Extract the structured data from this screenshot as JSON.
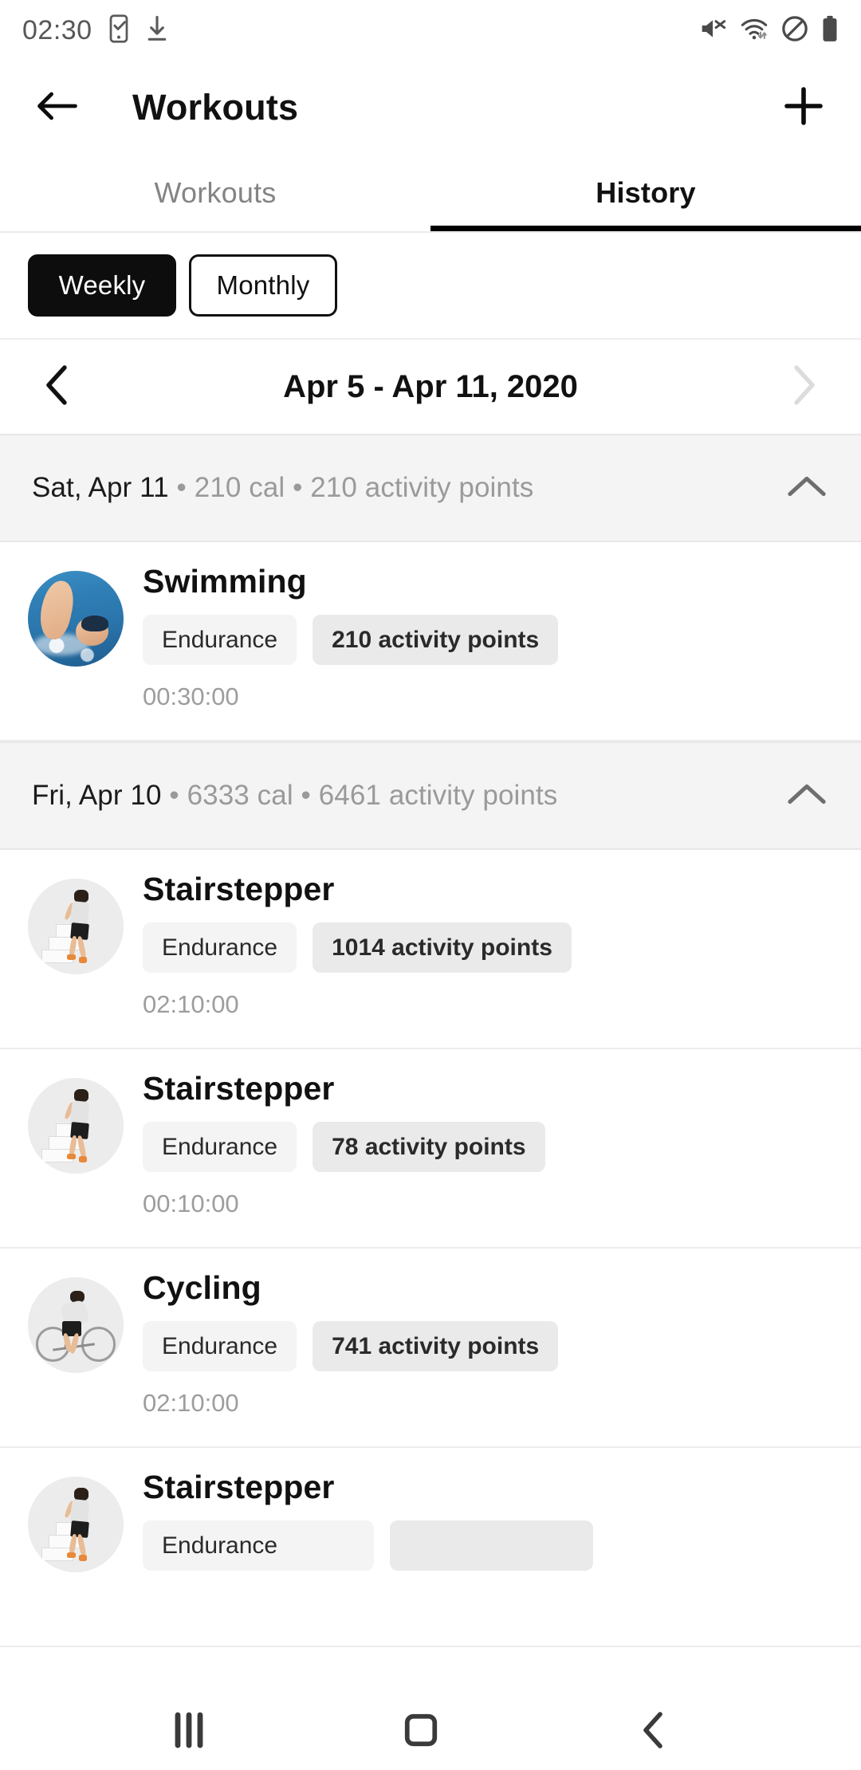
{
  "status_bar": {
    "time": "02:30",
    "left_icons": [
      "phone-check-icon",
      "download-icon"
    ],
    "right_icons": [
      "mute-icon",
      "wifi-icon",
      "do-not-disturb-icon",
      "battery-icon"
    ]
  },
  "app_bar": {
    "back_icon": "back-arrow-icon",
    "title": "Workouts",
    "add_icon": "plus-icon"
  },
  "tabs": [
    {
      "label": "Workouts",
      "active": false
    },
    {
      "label": "History",
      "active": true
    }
  ],
  "period_filter": {
    "options": [
      {
        "label": "Weekly",
        "selected": true
      },
      {
        "label": "Monthly",
        "selected": false
      }
    ]
  },
  "date_nav": {
    "prev_icon": "chevron-left-icon",
    "range": "Apr 5 - Apr 11, 2020",
    "next_icon": "chevron-right-icon",
    "prev_enabled": true,
    "next_enabled": false
  },
  "days": [
    {
      "date": "Sat, Apr 11",
      "separator": " • ",
      "calories": "210 cal",
      "points": "210 activity points",
      "collapse_icon": "chevron-up-icon",
      "workouts": [
        {
          "name": "Swimming",
          "type": "Endurance",
          "points": "210 activity points",
          "duration": "00:30:00",
          "thumb": "swimming-photo"
        }
      ]
    },
    {
      "date": "Fri, Apr 10",
      "separator": " • ",
      "calories": "6333 cal",
      "points": "6461 activity points",
      "collapse_icon": "chevron-up-icon",
      "workouts": [
        {
          "name": "Stairstepper",
          "type": "Endurance",
          "points": "1014 activity points",
          "duration": "02:10:00",
          "thumb": "stairstepper-illustration"
        },
        {
          "name": "Stairstepper",
          "type": "Endurance",
          "points": "78 activity points",
          "duration": "00:10:00",
          "thumb": "stairstepper-illustration"
        },
        {
          "name": "Cycling",
          "type": "Endurance",
          "points": "741 activity points",
          "duration": "02:10:00",
          "thumb": "cycling-illustration"
        },
        {
          "name": "Stairstepper",
          "type": "Endurance",
          "points": "",
          "duration": "",
          "thumb": "stairstepper-illustration"
        }
      ]
    }
  ],
  "gesture_nav": {
    "recents_icon": "recents-icon",
    "home_icon": "home-icon",
    "back_icon": "back-chevron-icon"
  },
  "colors": {
    "accent": "#000000",
    "header_band": "#f4f4f4",
    "chip_type_bg": "#f4f4f4",
    "chip_points_bg": "#eaeaea",
    "muted_text": "#9a9a9a"
  }
}
